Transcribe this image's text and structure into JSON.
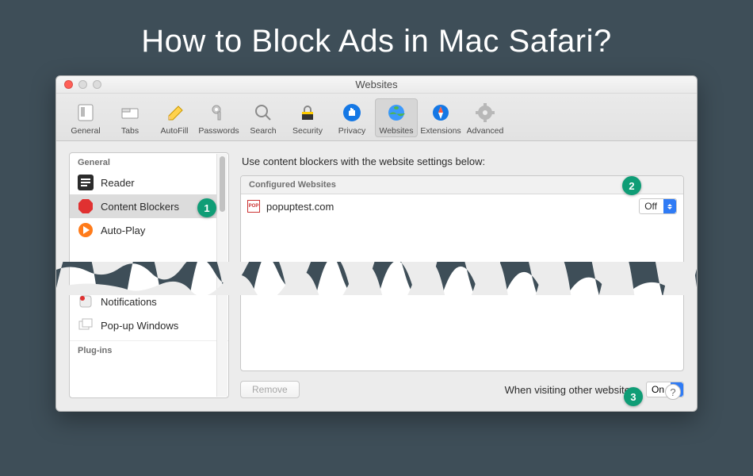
{
  "page": {
    "title": "How to Block Ads in Mac Safari?"
  },
  "window": {
    "title": "Websites"
  },
  "toolbar": {
    "items": [
      {
        "label": "General"
      },
      {
        "label": "Tabs"
      },
      {
        "label": "AutoFill"
      },
      {
        "label": "Passwords"
      },
      {
        "label": "Search"
      },
      {
        "label": "Security"
      },
      {
        "label": "Privacy"
      },
      {
        "label": "Websites"
      },
      {
        "label": "Extensions"
      },
      {
        "label": "Advanced"
      }
    ]
  },
  "sidebar": {
    "section1_header": "General",
    "section2_header": "Plug-ins",
    "items": [
      {
        "label": "Reader"
      },
      {
        "label": "Content Blockers"
      },
      {
        "label": "Auto-Play"
      },
      {
        "label": "Notifications"
      },
      {
        "label": "Pop-up Windows"
      }
    ]
  },
  "main": {
    "instruction": "Use content blockers with the website settings below:",
    "table_header": "Configured Websites",
    "rows": [
      {
        "site": "popuptest.com",
        "value": "Off"
      }
    ],
    "remove_label": "Remove",
    "other_label": "When visiting other websites:",
    "other_value": "On"
  },
  "callouts": {
    "b1": "1",
    "b2": "2",
    "b3": "3"
  },
  "help": {
    "label": "?"
  }
}
